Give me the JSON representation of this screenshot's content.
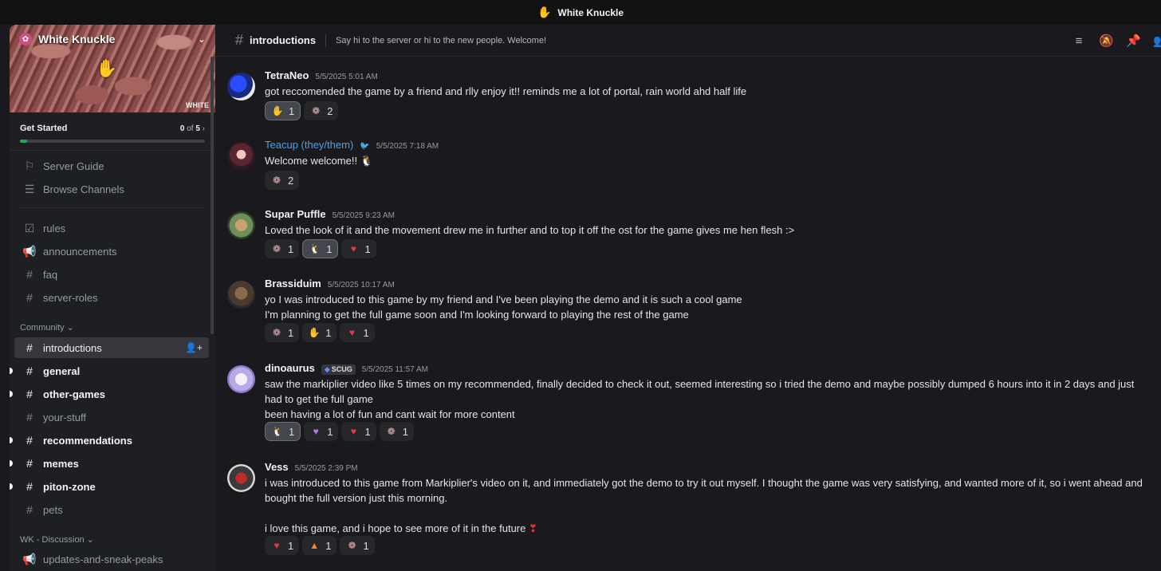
{
  "window": {
    "title": "White Knuckle",
    "icon": "hand-icon"
  },
  "server": {
    "name": "White Knuckle",
    "banner_watermark": "WHITE"
  },
  "get_started": {
    "label": "Get Started",
    "done": "0",
    "of": "of",
    "total": "5",
    "progress": 0.04
  },
  "nav": {
    "server_guide": "Server Guide",
    "browse_channels": "Browse Channels",
    "channels": [
      {
        "name": "rules",
        "icon": "rules-icon",
        "state": "read"
      },
      {
        "name": "announcements",
        "icon": "megaphone-icon",
        "state": "read"
      },
      {
        "name": "faq",
        "icon": "hash-icon",
        "state": "read"
      },
      {
        "name": "server-roles",
        "icon": "hash-icon",
        "state": "read"
      }
    ],
    "category_community": "Community",
    "community": [
      {
        "name": "introductions",
        "state": "selected"
      },
      {
        "name": "general",
        "state": "unread"
      },
      {
        "name": "other-games",
        "state": "unread"
      },
      {
        "name": "your-stuff",
        "state": "read"
      },
      {
        "name": "recommendations",
        "state": "unread"
      },
      {
        "name": "memes",
        "state": "unread"
      },
      {
        "name": "piton-zone",
        "state": "unread"
      },
      {
        "name": "pets",
        "state": "read"
      }
    ],
    "category_discussion": "WK - Discussion",
    "discussion": [
      {
        "name": "updates-and-sneak-peaks",
        "icon": "megaphone-icon",
        "state": "read"
      }
    ]
  },
  "header": {
    "channel": "introductions",
    "topic": "Say hi to the server or hi to the new people. Welcome!",
    "tools": [
      "threads-icon",
      "mute-icon",
      "pin-icon",
      "members-icon"
    ]
  },
  "messages": [
    {
      "author": "TetraNeo",
      "timestamp": "5/5/2025 5:01 AM",
      "lines": [
        "got reccomended the game by a friend and rlly enjoy it!! reminds me a lot of portal, rain world ahd half life"
      ],
      "reactions": [
        {
          "emoji": "hand-emoji",
          "count": "1",
          "mine": true
        },
        {
          "emoji": "brain-emoji",
          "count": "2",
          "mine": false
        }
      ]
    },
    {
      "author": "Teacup (they/them)",
      "timestamp": "5/5/2025 7:18 AM",
      "lines": [
        "Welcome welcome!!"
      ],
      "reactions": [
        {
          "emoji": "brain-emoji",
          "count": "2",
          "mine": false
        }
      ]
    },
    {
      "author": "Supar Puffle",
      "timestamp": "5/5/2025 9:23 AM",
      "lines": [
        "Loved the look of it and the movement drew me in further and to top it off the ost for the game gives me hen flesh :>"
      ],
      "reactions": [
        {
          "emoji": "brain-emoji",
          "count": "1",
          "mine": false
        },
        {
          "emoji": "bird-emoji",
          "count": "1",
          "mine": true
        },
        {
          "emoji": "heart-emoji",
          "count": "1",
          "mine": false
        }
      ]
    },
    {
      "author": "Brassiduim",
      "timestamp": "5/5/2025 10:17 AM",
      "lines": [
        "yo I was introduced to this game by my friend and I've been playing the demo and it is such a cool game",
        "I'm planning to get the full game soon and I'm looking forward to playing the rest of the game"
      ],
      "reactions": [
        {
          "emoji": "brain-emoji",
          "count": "1",
          "mine": false
        },
        {
          "emoji": "hand-emoji",
          "count": "1",
          "mine": false
        },
        {
          "emoji": "heart-emoji",
          "count": "1",
          "mine": false
        }
      ]
    },
    {
      "author": "dinoaurus",
      "tag": "SCUG",
      "timestamp": "5/5/2025 11:57 AM",
      "lines": [
        "saw the markiplier video like 5 times on my recommended, finally decided to check it out, seemed interesting so i tried the demo and maybe possibly dumped 6 hours into it in 2 days and just had to get the full game",
        "been having a lot of fun and cant wait for more content"
      ],
      "reactions": [
        {
          "emoji": "bird-emoji",
          "count": "1",
          "mine": true
        },
        {
          "emoji": "purple-heart-emoji",
          "count": "1",
          "mine": false
        },
        {
          "emoji": "heart-emoji",
          "count": "1",
          "mine": false
        },
        {
          "emoji": "brain-emoji",
          "count": "1",
          "mine": false
        }
      ]
    },
    {
      "author": "Vess",
      "timestamp": "5/5/2025 2:39 PM",
      "lines": [
        "i was introduced to this game from Markiplier's video on it, and immediately got the demo to try it out myself. I thought the game was very satisfying, and wanted more of it, so i went ahead and bought the full version just this morning.",
        "",
        "i love this game, and i hope to see more of it in the future"
      ],
      "reactions": [
        {
          "emoji": "heart-emoji",
          "count": "1",
          "mine": false
        },
        {
          "emoji": "fire-emoji",
          "count": "1",
          "mine": false
        },
        {
          "emoji": "brain-emoji",
          "count": "1",
          "mine": false
        }
      ]
    }
  ],
  "colors": {
    "accent_green": "#23a55a",
    "author_blue": "#4aa3e8",
    "heart": "#e8364e"
  }
}
